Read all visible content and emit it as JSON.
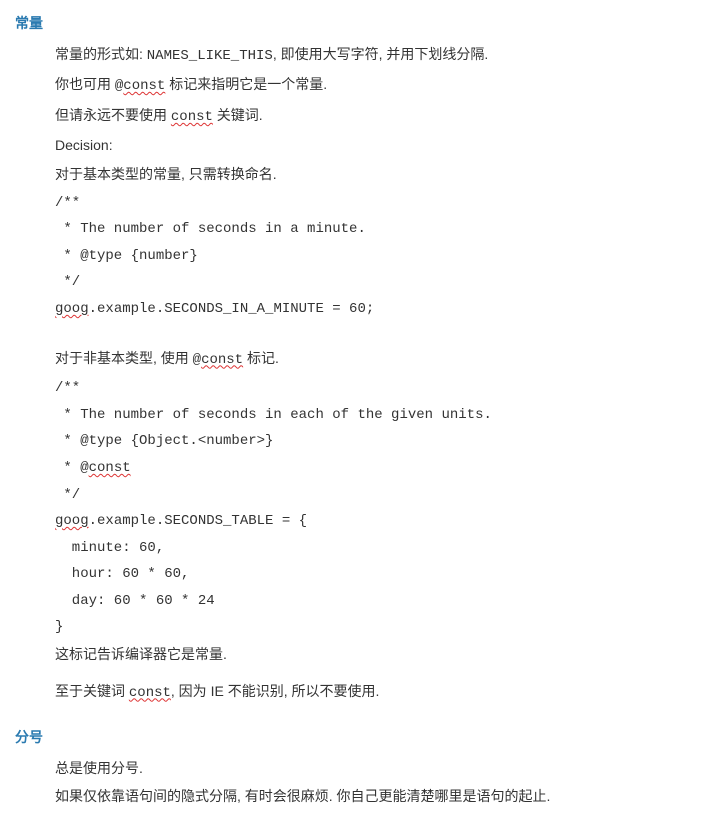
{
  "section1": {
    "title": "常量",
    "p1_pre": "常量的形式如: ",
    "p1_code": "NAMES_LIKE_THIS",
    "p1_post": ", 即使用大写字符, 并用下划线分隔.",
    "p2_pre": "你也可用 ",
    "p2_at": "@",
    "p2_const": "const",
    "p2_post": " 标记来指明它是一个常量.",
    "p3_pre": "但请永远不要使用 ",
    "p3_const": "const",
    "p3_post": " 关键词.",
    "p4": "Decision:",
    "p5": "对于基本类型的常量, 只需转换命名.",
    "code1_l1": "/**",
    "code1_l2": " * The number of seconds in a minute.",
    "code1_l3": " * @type {number}",
    "code1_l4": " */",
    "code1_l5_pre": "goog",
    "code1_l5_post": ".example.SECONDS_IN_A_MINUTE = 60;",
    "p6_pre": "对于非基本类型, 使用 ",
    "p6_at": "@",
    "p6_const": "const",
    "p6_post": " 标记.",
    "code2_l1": "/**",
    "code2_l2": " * The number of seconds in each of the given units.",
    "code2_l3": " * @type {Object.<number>}",
    "code2_l4_pre": " * @",
    "code2_l4_const": "const",
    "code2_l5": " */",
    "code2_l6_pre": "goog",
    "code2_l6_post": ".example.SECONDS_TABLE = {",
    "code2_l7": "  minute: 60,",
    "code2_l8": "  hour: 60 * 60,",
    "code2_l9": "  day: 60 * 60 * 24",
    "code2_l10": "}",
    "p7": "这标记告诉编译器它是常量.",
    "p8_pre": "至于关键词 ",
    "p8_const": "const",
    "p8_post": ",  因为 IE 不能识别, 所以不要使用."
  },
  "section2": {
    "title": "分号",
    "p1": "总是使用分号.",
    "p2": "如果仅依靠语句间的隐式分隔, 有时会很麻烦. 你自己更能清楚哪里是语句的起止."
  }
}
